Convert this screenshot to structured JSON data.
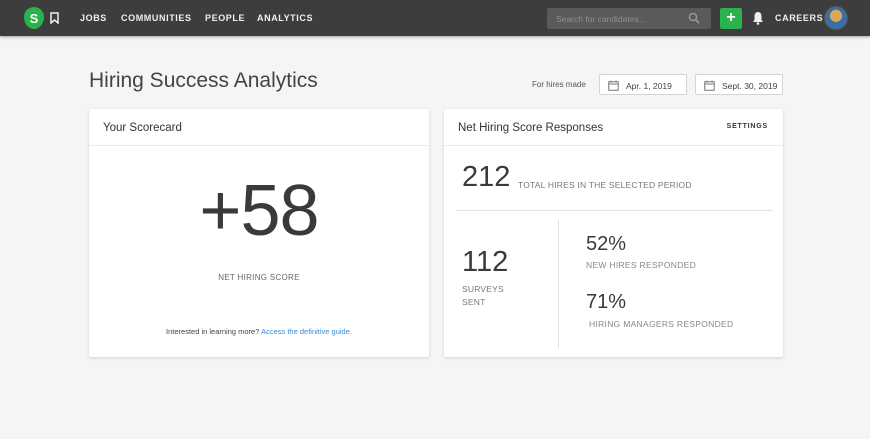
{
  "nav": {
    "logo_letter": "S",
    "links": [
      "JOBS",
      "COMMUNITIES",
      "PEOPLE",
      "ANALYTICS"
    ],
    "search_placeholder": "Search for candidates...",
    "add_label": "+",
    "careers_label": "CAREERS"
  },
  "header": {
    "title": "Hiring Success Analytics",
    "range_label": "For hires made",
    "start_date": "Apr. 1, 2019",
    "end_date": "Sept. 30, 2019"
  },
  "scorecard": {
    "title": "Your Scorecard",
    "score": "+58",
    "score_label": "NET HIRING SCORE",
    "learn_more_text": "Interested in learning more?",
    "learn_more_link": "Access the definitive guide."
  },
  "responses": {
    "title": "Net Hiring Score Responses",
    "settings_label": "SETTINGS",
    "total_hires": "212",
    "total_hires_label": "TOTAL HIRES IN THE SELECTED PERIOD",
    "surveys_sent": "112",
    "surveys_sent_label": "SURVEYS SENT",
    "new_hires_pct": "52%",
    "new_hires_label": "NEW HIRES RESPONDED",
    "managers_pct": "71%",
    "managers_label": "HIRING MANAGERS RESPONDED"
  },
  "colors": {
    "brand_green": "#2bb24c",
    "topbar": "#3d3d3d",
    "link_blue": "#3a8ad6"
  }
}
